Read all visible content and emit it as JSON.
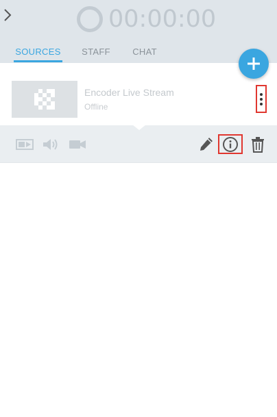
{
  "header": {
    "timer": "00:00:00"
  },
  "tabs": [
    {
      "label": "SOURCES",
      "active": true
    },
    {
      "label": "STAFF",
      "active": false
    },
    {
      "label": "CHAT",
      "active": false
    }
  ],
  "source": {
    "name": "Encoder Live Stream",
    "status": "Offline"
  },
  "toolbar": {
    "left_icons": [
      "video-source-icon",
      "volume-icon",
      "camera-icon"
    ],
    "right_icons": [
      "pencil-icon",
      "info-icon",
      "trash-icon"
    ]
  },
  "colors": {
    "accent": "#3aa6e0",
    "highlight": "#e0362f",
    "header_bg": "#dfe5ea",
    "toolbar_bg": "#eaeef1"
  }
}
